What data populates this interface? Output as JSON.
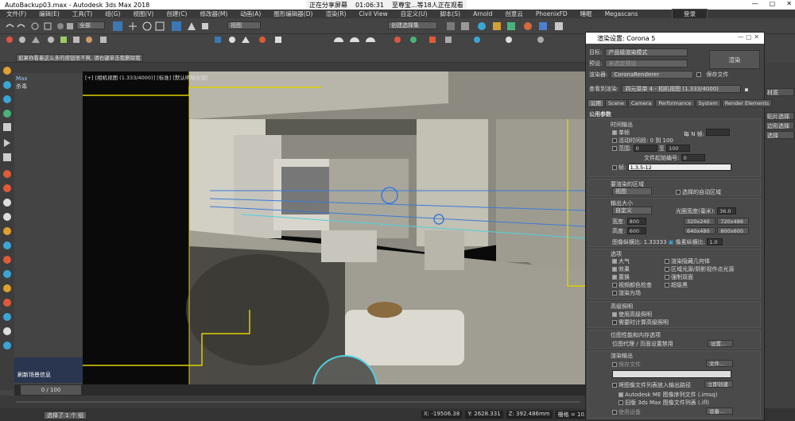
{
  "titlebar": {
    "title": "AutoBackup03.max - Autodesk 3ds Max 2018",
    "share": "正在分享屏幕",
    "timer": "01:06:31",
    "viewers": "至尊宝...等18人正在观看"
  },
  "menu": [
    "文件(F)",
    "编辑(E)",
    "工具(T)",
    "组(G)",
    "视图(V)",
    "创建(C)",
    "修改器(M)",
    "动画(A)",
    "图形编辑器(D)",
    "渲染(R)",
    "Civil View",
    "自定义(U)",
    "脚本(S)",
    "Arnold",
    "创意云",
    "PhoenixFD",
    "睡眠",
    "Megascans"
  ],
  "login_label": "登录",
  "toolbar": {
    "undo_scope": "全部",
    "view_select": "视图",
    "selection_set": "创建选择集"
  },
  "script_buttons": [
    "选项",
    "主界面",
    "刷新场景信息",
    "清空材质球(Std)",
    "清空材质球(VR)",
    "清空材质球(Arch)",
    "导入所有材质",
    "中文VRay AO",
    "英文VRay AO",
    "VRay 代理",
    "重命名",
    "随机操作",
    "材质转换",
    "整理丢失贴图",
    "转换到插件",
    "修改所有VRay灯光",
    "你可以用脚本管理器添加扩展功能"
  ],
  "script_note": "如果你看着这么多的按钮很不爽, 请右键单击我删除我",
  "viewport": {
    "label": "[+] [相机视图 (1.333/4000)] [标准] [默认明暗处理]"
  },
  "cmd_panel": {
    "max_label": "Max",
    "killer_label": "杀毒"
  },
  "scene_panel": {
    "refresh_label": "刷新场景信息"
  },
  "timeline": {
    "frame": "0 / 100"
  },
  "status": {
    "selected": "选择了 1 个 组",
    "x": "X: -19506.38",
    "y": "Y: 2628.331",
    "z": "Z: 392.486mm",
    "grid": "栅格 = 10.0mm"
  },
  "right_panel": [
    "材质",
    "贴片选择",
    "边形选择",
    "选择",
    "hidden"
  ],
  "dialog": {
    "title": "渲染设置: Corona 5",
    "target_label": "目标:",
    "target_value": "产品级渲染模式",
    "preset_label": "预设:",
    "preset_value": "未选定预设",
    "renderer_label": "渲染器:",
    "renderer_value": "CoronaRenderer",
    "save_file_label": "保存文件",
    "view_label": "查看到渲染:",
    "view_value": "四元菜单 4 - 相机视图 (1.333/4000)",
    "render_button": "渲染",
    "tabs": [
      "公用",
      "Scene",
      "Camera",
      "Performance",
      "System",
      "Render Elements"
    ],
    "common_params": "公用参数",
    "time_output": "时间输出",
    "single": "单帧",
    "every_n": "每 N 帧:",
    "active_segment": "活动时间段:",
    "active_range": "0 到 100",
    "range": "范围:",
    "range_from": "0",
    "range_to": "100",
    "to": "至",
    "file_start": "文件起始编号:",
    "file_start_val": "0",
    "frames": "帧:",
    "frames_val": "1,3,5-12",
    "area_title": "要渲染的区域",
    "area_value": "视图",
    "auto_region": "选择的自动区域",
    "output_size": "输出大小",
    "size_preset": "自定义",
    "aperture": "光圈宽度(毫米):",
    "aperture_val": "36.0",
    "width_label": "宽度:",
    "width_val": "800",
    "height_label": "高度:",
    "height_val": "600",
    "presets": [
      "320x240",
      "720x486",
      "640x480",
      "800x600"
    ],
    "aspect_label": "图像纵横比:",
    "aspect_val": "1.33333",
    "pixel_aspect_label": "像素纵横比:",
    "pixel_aspect_val": "1.0",
    "options_title": "选项",
    "options": [
      "大气",
      "渲染隐藏几何体",
      "效果",
      "区域光源/阴影视作点光源",
      "置换",
      "强制双面",
      "视频颜色检查",
      "超级黑",
      "渲染为场"
    ],
    "adv_light": "高级照明",
    "use_adv": "使用高级照明",
    "compute_adv": "需要时计算高级照明",
    "bitmap_perf": "位图性能和内存选项",
    "bitmap_desc": "位图代理 / 页面设置禁用",
    "settings_btn": "设置...",
    "render_output": "渲染输出",
    "save_file": "保存文件",
    "files_btn": "文件...",
    "put_image_seq": "将图像文件列表放入输出路径",
    "create_now": "立即创建",
    "autodesk_seq": "Autodesk ME 图像序列文件 (.imsq)",
    "legacy_seq": "旧版 3ds Max 图像文件列表 (.ifl)",
    "use_device": "使用设备",
    "device_btn": "设备..."
  }
}
